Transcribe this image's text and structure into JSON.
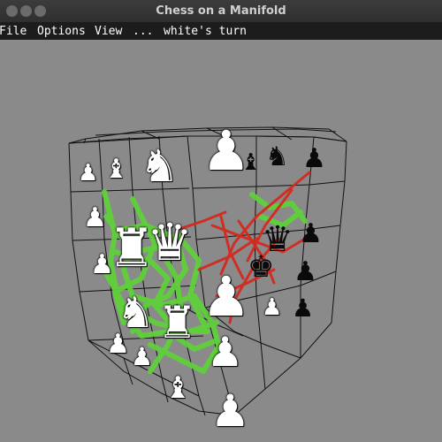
{
  "window": {
    "title": "Chess on a Manifold"
  },
  "menu": [
    {
      "label": "File"
    },
    {
      "label": "Options"
    },
    {
      "label": "View"
    },
    {
      "label": "..."
    },
    {
      "label": "white's turn"
    }
  ],
  "board": {
    "pieces": [
      {
        "color": "white",
        "type": "pawn",
        "glyph": "♟"
      },
      {
        "color": "white",
        "type": "bishop",
        "glyph": "♝"
      },
      {
        "color": "white",
        "type": "knight",
        "glyph": "♞"
      },
      {
        "color": "white",
        "type": "pawn",
        "glyph": "♟"
      },
      {
        "color": "black",
        "type": "bishop",
        "glyph": "♝"
      },
      {
        "color": "black",
        "type": "knight",
        "glyph": "♞"
      },
      {
        "color": "black",
        "type": "pawn",
        "glyph": "♟"
      },
      {
        "color": "white",
        "type": "pawn",
        "glyph": "♟"
      },
      {
        "color": "white",
        "type": "rook",
        "glyph": "♜"
      },
      {
        "color": "white",
        "type": "queen",
        "glyph": "♛"
      },
      {
        "color": "black",
        "type": "queen",
        "glyph": "♛"
      },
      {
        "color": "black",
        "type": "pawn",
        "glyph": "♟"
      },
      {
        "color": "white",
        "type": "pawn",
        "glyph": "♟"
      },
      {
        "color": "black",
        "type": "king",
        "glyph": "♚"
      },
      {
        "color": "black",
        "type": "pawn",
        "glyph": "♟"
      },
      {
        "color": "white",
        "type": "pawn",
        "glyph": "♟"
      },
      {
        "color": "white",
        "type": "knight",
        "glyph": "♞"
      },
      {
        "color": "white",
        "type": "rook",
        "glyph": "♜"
      },
      {
        "color": "white",
        "type": "pawn",
        "glyph": "♟"
      },
      {
        "color": "black",
        "type": "pawn",
        "glyph": "♟"
      },
      {
        "color": "white",
        "type": "pawn",
        "glyph": "♟"
      },
      {
        "color": "white",
        "type": "pawn",
        "glyph": "♟"
      },
      {
        "color": "white",
        "type": "pawn",
        "glyph": "♟"
      },
      {
        "color": "white",
        "type": "bishop",
        "glyph": "♝"
      },
      {
        "color": "white",
        "type": "pawn",
        "glyph": "♟"
      }
    ],
    "colors": {
      "background": "#8a8a8a",
      "grid": "#111111",
      "white_moves": "#5fd03a",
      "black_moves": "#d42a1e"
    }
  }
}
